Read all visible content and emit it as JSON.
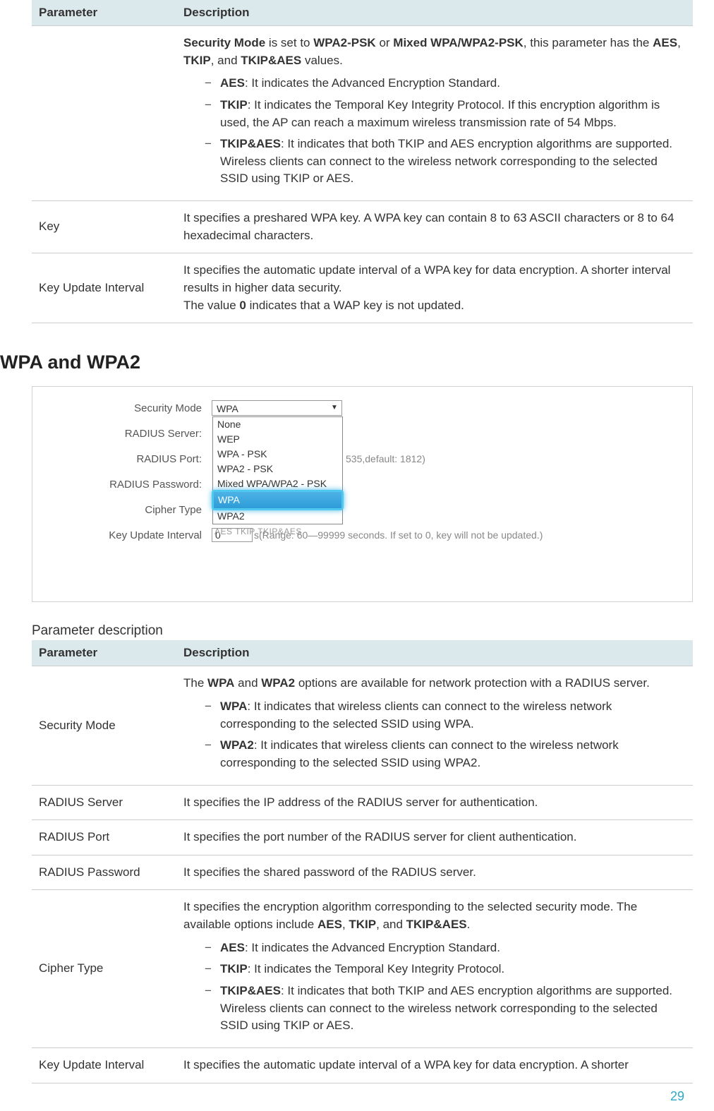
{
  "table1": {
    "headers": {
      "param": "Parameter",
      "desc": "Description"
    },
    "row0": {
      "intro_pre": "Security Mode",
      "intro_mid1": " is set to ",
      "intro_b1": "WPA2-PSK",
      "intro_mid2": " or ",
      "intro_b2": "Mixed WPA/WPA2-PSK",
      "intro_mid3": ", this parameter has the ",
      "intro_b3": "AES",
      "intro_mid4": ", ",
      "intro_b4": "TKIP",
      "intro_mid5": ", and ",
      "intro_b5": "TKIP&AES",
      "intro_end": " values.",
      "li1_b": "AES",
      "li1_t": ": It indicates the Advanced Encryption Standard.",
      "li2_b": "TKIP",
      "li2_t": ": It indicates the Temporal Key Integrity Protocol. If this encryption algorithm is used, the AP can reach a maximum wireless transmission rate of 54 Mbps.",
      "li3_b": "TKIP&AES",
      "li3_t": ": It indicates that both TKIP and AES encryption algorithms are supported. Wireless clients can connect to the wireless network corresponding to the selected SSID using TKIP or AES."
    },
    "row1": {
      "name": "Key",
      "desc": "It specifies a preshared WPA key. A WPA key can contain 8 to 63 ASCII characters or 8 to 64 hexadecimal characters."
    },
    "row2": {
      "name": "Key Update Interval",
      "desc_p1": "It specifies the automatic update interval of a WPA key for data encryption. A shorter interval results in higher data security.",
      "desc_p2_pre": "The value ",
      "desc_p2_b": "0",
      "desc_p2_post": " indicates that a WAP key is not updated."
    }
  },
  "heading2": "WPA and WPA2",
  "shot": {
    "labels": {
      "secmode": "Security Mode",
      "radius_server": "RADIUS Server:",
      "radius_port": "RADIUS Port:",
      "radius_pwd": "RADIUS Password:",
      "cipher": "Cipher Type",
      "keyupd": "Key Update Interval"
    },
    "select_value": "WPA",
    "options": {
      "o1": "None",
      "o2": "WEP",
      "o3": "WPA - PSK",
      "o4": "WPA2 - PSK",
      "o5": "Mixed WPA/WPA2 - PSK",
      "o6": "WPA",
      "o7": "WPA2"
    },
    "port_hint": "535,default: 1812)",
    "cipher_overlay": "AES   TKIP   TKIP&AES",
    "keyupd_value": "0",
    "keyupd_hint": "s(Range: 60—99999 seconds. If set to 0, key will not be updated.)"
  },
  "caption2": "Parameter description",
  "table2": {
    "headers": {
      "param": "Parameter",
      "desc": "Description"
    },
    "r0": {
      "name": "Security Mode",
      "intro_pre": "The ",
      "intro_b1": "WPA",
      "intro_mid1": " and ",
      "intro_b2": "WPA2",
      "intro_end": " options are available for network protection with a RADIUS server.",
      "li1_b": "WPA",
      "li1_t": ": It indicates that wireless clients can connect to the wireless network corresponding to the selected SSID using WPA.",
      "li2_b": "WPA2",
      "li2_t": ": It indicates that wireless clients can connect to the wireless network corresponding to the selected SSID using WPA2."
    },
    "r1": {
      "name": "RADIUS Server",
      "desc": "It specifies the IP address of the RADIUS server for authentication."
    },
    "r2": {
      "name": "RADIUS Port",
      "desc": "It specifies the port number of the RADIUS server for client authentication."
    },
    "r3": {
      "name": "RADIUS Password",
      "desc": "It specifies the shared password of the RADIUS server."
    },
    "r4": {
      "name": "Cipher Type",
      "intro_pre": "It specifies the encryption algorithm corresponding to the selected security mode. The available options include ",
      "intro_b1": "AES",
      "intro_m1": ", ",
      "intro_b2": "TKIP",
      "intro_m2": ", and ",
      "intro_b3": "TKIP&AES",
      "intro_end": ".",
      "li1_b": "AES",
      "li1_t": ": It indicates the Advanced Encryption Standard.",
      "li2_b": "TKIP",
      "li2_t": ": It indicates the Temporal Key Integrity Protocol.",
      "li3_b": "TKIP&AES",
      "li3_t": ": It indicates that both TKIP and AES encryption algorithms are supported. Wireless clients can connect to the wireless network corresponding to the selected SSID using TKIP or AES."
    },
    "r5": {
      "name": "Key Update Interval",
      "desc": "It specifies the automatic update interval of a WPA key for data encryption. A shorter"
    }
  },
  "page_number": "29"
}
